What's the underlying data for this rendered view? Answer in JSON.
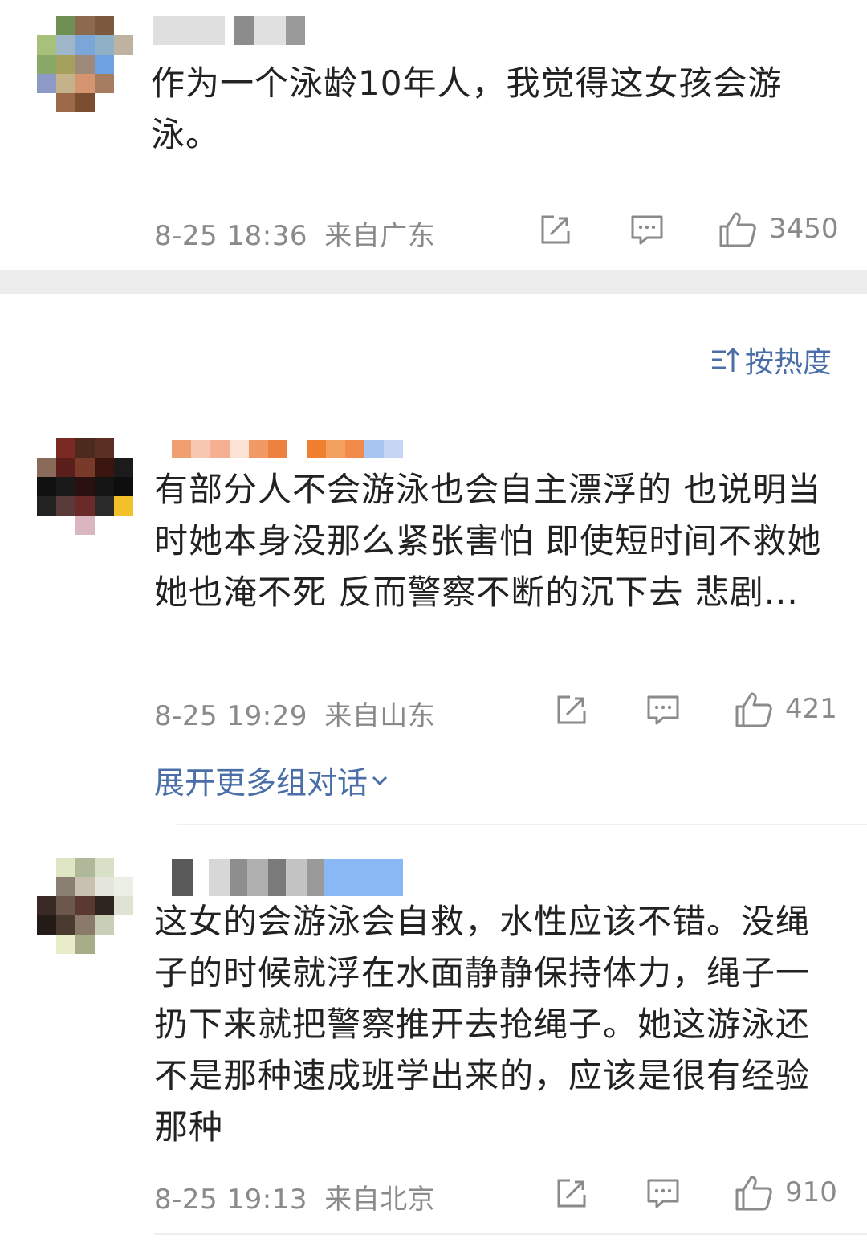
{
  "comments": [
    {
      "text": "作为一个泳龄10年人，我觉得这女孩会游泳。",
      "time": "8-25 18:36",
      "location": "来自广东",
      "likes": "3450"
    },
    {
      "text": "有部分人不会游泳也会自主漂浮的 也说明当时她本身没那么紧张害怕 即使短时间不救她 她也淹不死 反而警察不断的沉下去 悲剧...",
      "time": "8-25 19:29",
      "location": "来自山东",
      "likes": "421"
    },
    {
      "text": "这女的会游泳会自救，水性应该不错。没绳子的时候就浮在水面静静保持体力，绳子一扔下来就把警察推开去抢绳子。她这游泳还不是那种速成班学出来的，应该是很有经验那种",
      "time": "8-25 19:13",
      "location": "来自北京",
      "likes": "910"
    }
  ],
  "sort": {
    "label": "按热度",
    "icon": "sort-icon"
  },
  "expand": {
    "label": "展开更多组对话",
    "icon": "chevron-down-icon"
  },
  "colors": {
    "link": "#4a6fa8",
    "meta": "#8a8a8a",
    "text": "#222222",
    "band": "#ededed"
  }
}
